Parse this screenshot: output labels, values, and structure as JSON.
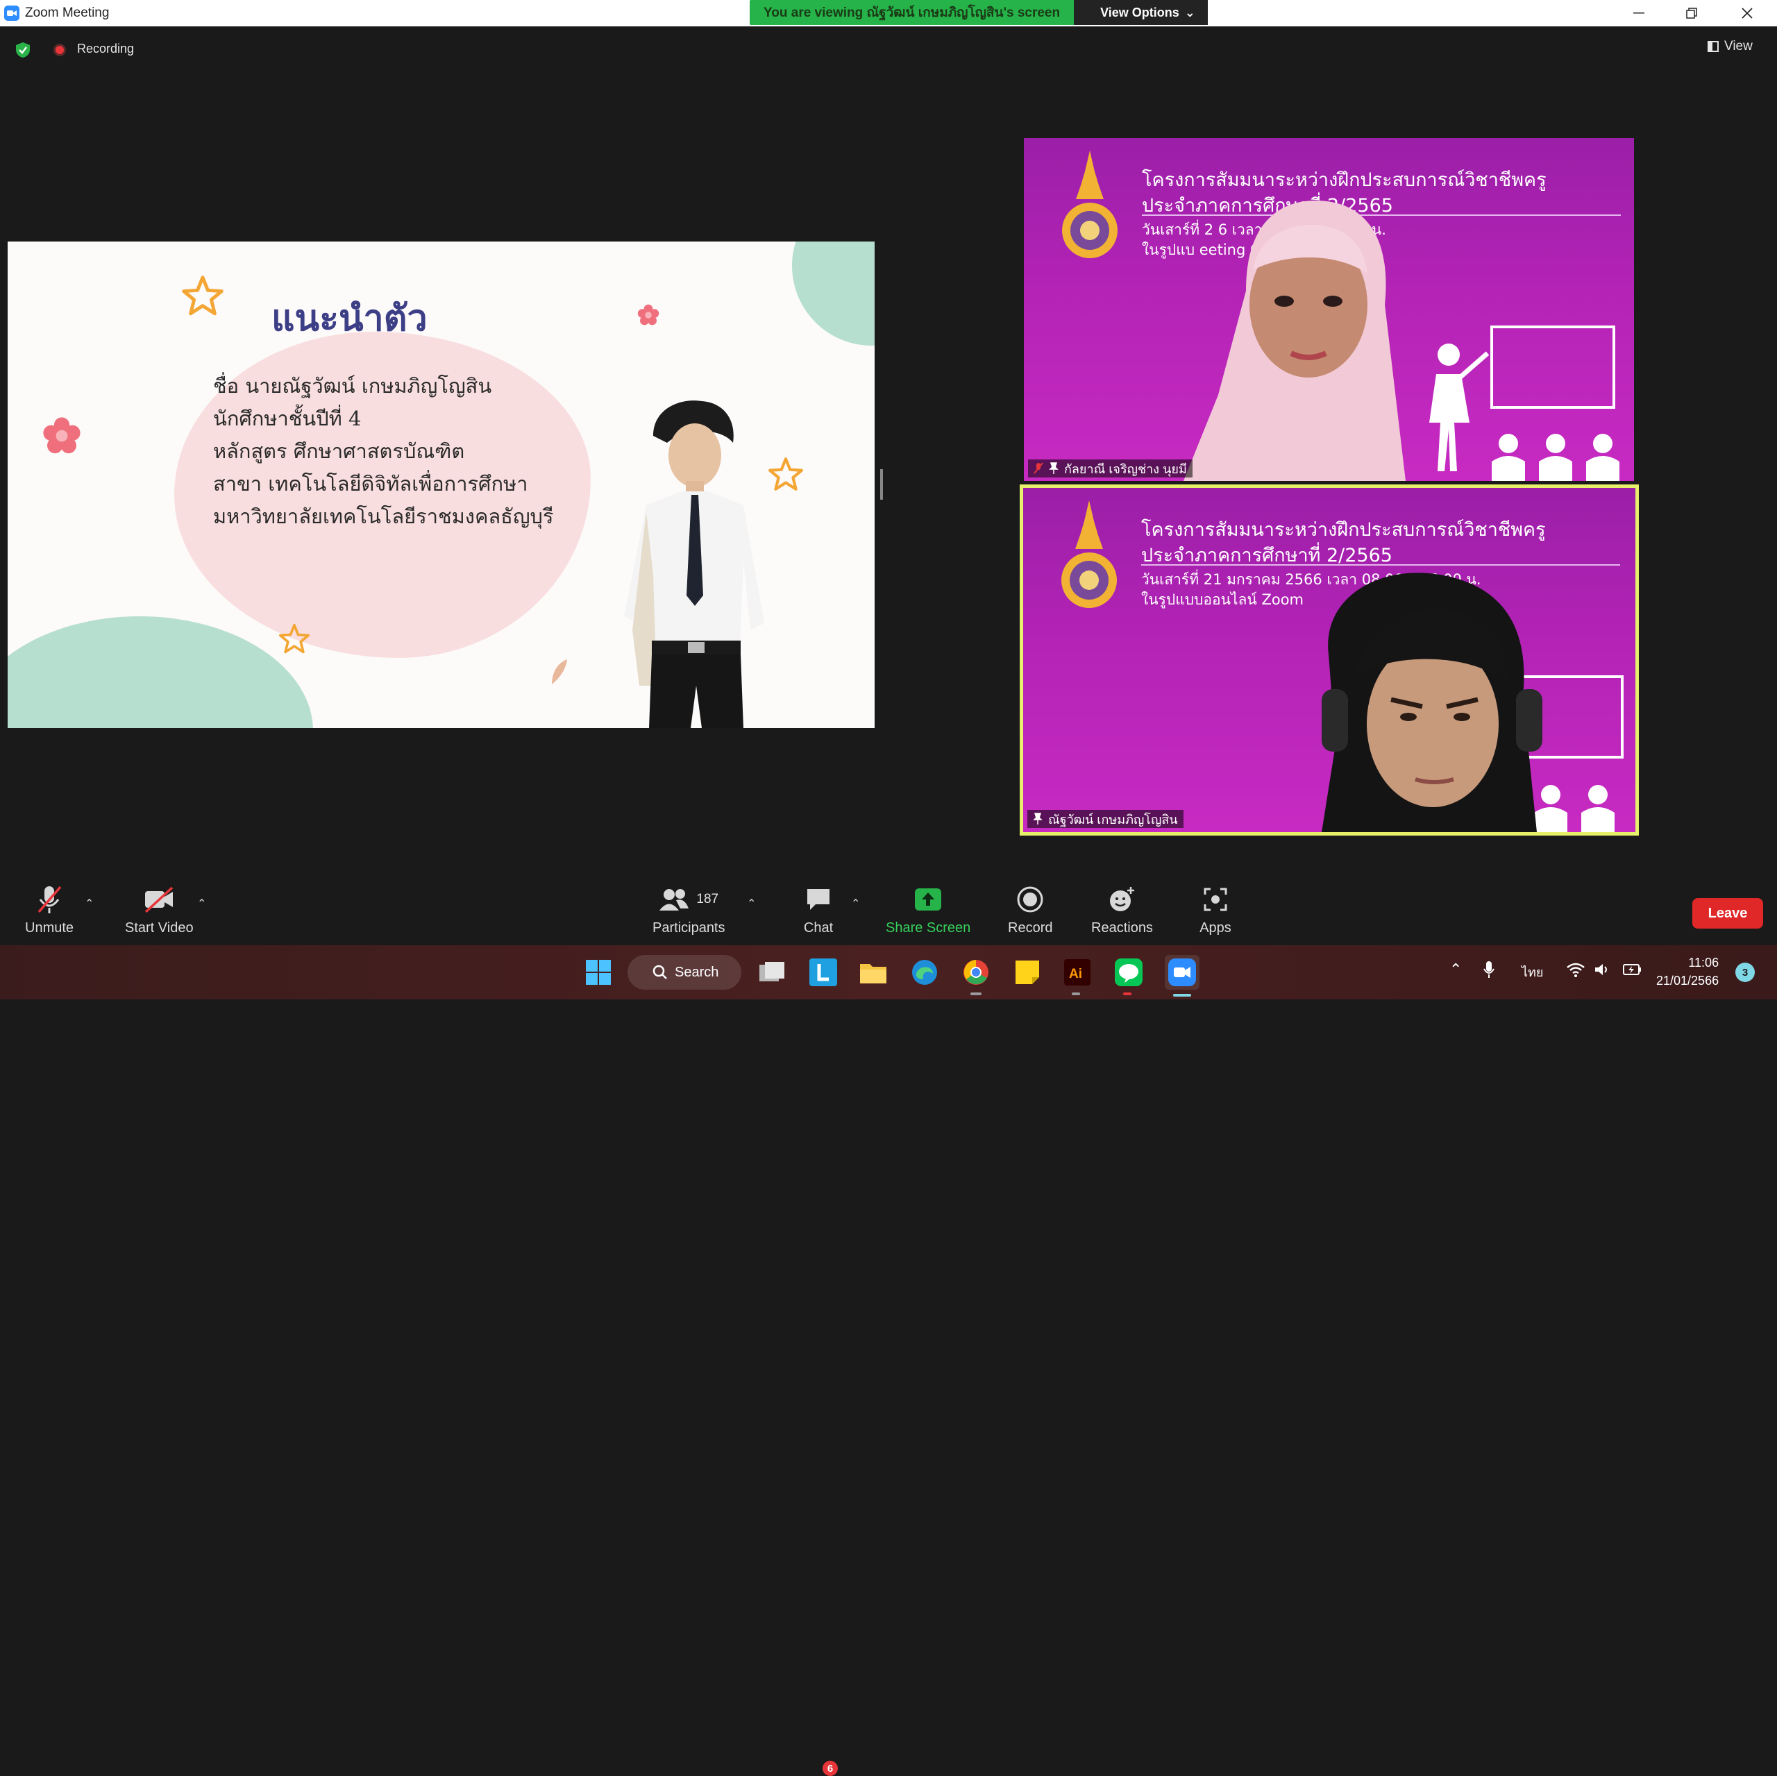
{
  "window": {
    "title": "Zoom Meeting"
  },
  "banner": {
    "viewing_text": "You are viewing ณัฐวัฒน์ เกษมภิญโญสิน's screen",
    "view_options_label": "View Options"
  },
  "status": {
    "recording_label": "Recording",
    "view_label": "View"
  },
  "slide": {
    "title": "แนะนำตัว",
    "lines": [
      "ชื่อ นายณัฐวัฒน์ เกษมภิญโญสิน",
      "นักศึกษาชั้นปีที่ 4",
      "หลักสูตร ศึกษาศาสตรบัณฑิต",
      "สาขา เทคโนโลยีดิจิทัลเพื่อการศึกษา",
      "มหาวิทยาลัยเทคโนโลยีราชมงคลธัญบุรี"
    ]
  },
  "tiles": [
    {
      "heading_1": "โครงการสัมมนาระหว่างฝึกประสบการณ์วิชาชีพครู",
      "heading_2": "ประจำภาคการศึกษาที่ 2/2565",
      "sub_1": "วันเสาร์ที่ 2 6 เวลา 08.00 – 16.00 น.",
      "sub_2": "ในรูปแบ eeting Online",
      "name": "กัลยาณี เจริญช่าง นุยมี"
    },
    {
      "heading_1": "โครงการสัมมนาระหว่างฝึกประสบการณ์วิชาชีพครู",
      "heading_2": "ประจำภาคการศึกษาที่ 2/2565",
      "sub_1": "วันเสาร์ที่ 21 มกราคม 2566 เวลา 08.00 – 16.00 น.",
      "sub_2": "ในรูปแบบออนไลน์ Zoom",
      "name": "ณัฐวัฒน์ เกษมภิญโญสิน"
    }
  ],
  "toolbar": {
    "unmute": "Unmute",
    "start_video": "Start Video",
    "participants": "Participants",
    "participants_count": "187",
    "chat": "Chat",
    "chat_badge": "6",
    "share_screen": "Share Screen",
    "record": "Record",
    "reactions": "Reactions",
    "apps": "Apps",
    "leave": "Leave"
  },
  "taskbar": {
    "search_label": "Search",
    "language": "ไทย",
    "time": "11:06",
    "date": "21/01/2566",
    "notification_count": "3"
  },
  "colors": {
    "share_green": "#25b34a",
    "leave_red": "#e02828",
    "active_speaker_border": "#e6f06a",
    "slide_title": "#3c3f86",
    "tile_bg": "#b423b6"
  }
}
